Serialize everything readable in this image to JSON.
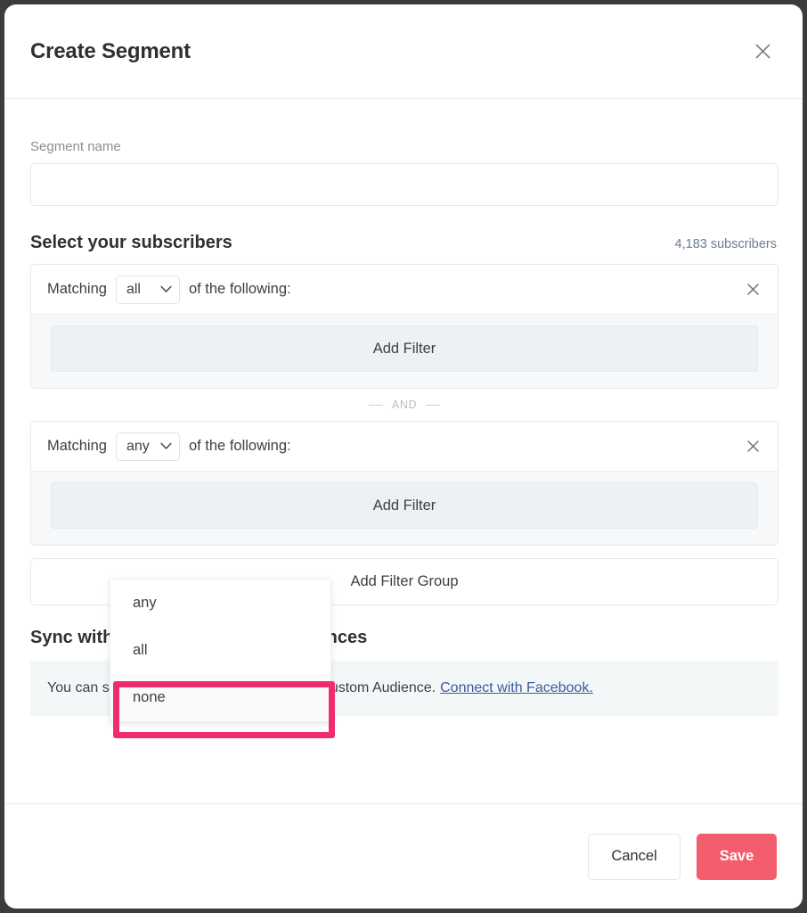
{
  "modal": {
    "title": "Create Segment",
    "close_icon": "close-icon"
  },
  "form": {
    "segment_name_label": "Segment name",
    "segment_name_value": "",
    "segment_name_placeholder": ""
  },
  "subscribers": {
    "section_title": "Select your subscribers",
    "count_label": "4,183 subscribers"
  },
  "groups": [
    {
      "prefix": "Matching",
      "selected": "all",
      "suffix": "of the following:",
      "add_filter_label": "Add Filter",
      "remove_icon": "close-icon"
    },
    {
      "prefix": "Matching",
      "selected": "any",
      "suffix": "of the following:",
      "add_filter_label": "Add Filter",
      "remove_icon": "close-icon"
    }
  ],
  "divider": {
    "label": "AND"
  },
  "add_filter_group": {
    "label": "Add Filter Group"
  },
  "dropdown": {
    "open": true,
    "options": [
      "any",
      "all",
      "none"
    ],
    "highlighted": "none",
    "highlight_color": "#ef2d6d"
  },
  "facebook": {
    "title": "Sync with Facebook Custom Audiences",
    "description": "You can sync your segment to a Facebook Custom Audience.",
    "link_label": "Connect with Facebook.",
    "link_color": "#3e5a9e"
  },
  "footer": {
    "cancel_label": "Cancel",
    "save_label": "Save",
    "save_color": "#f45d6b"
  }
}
